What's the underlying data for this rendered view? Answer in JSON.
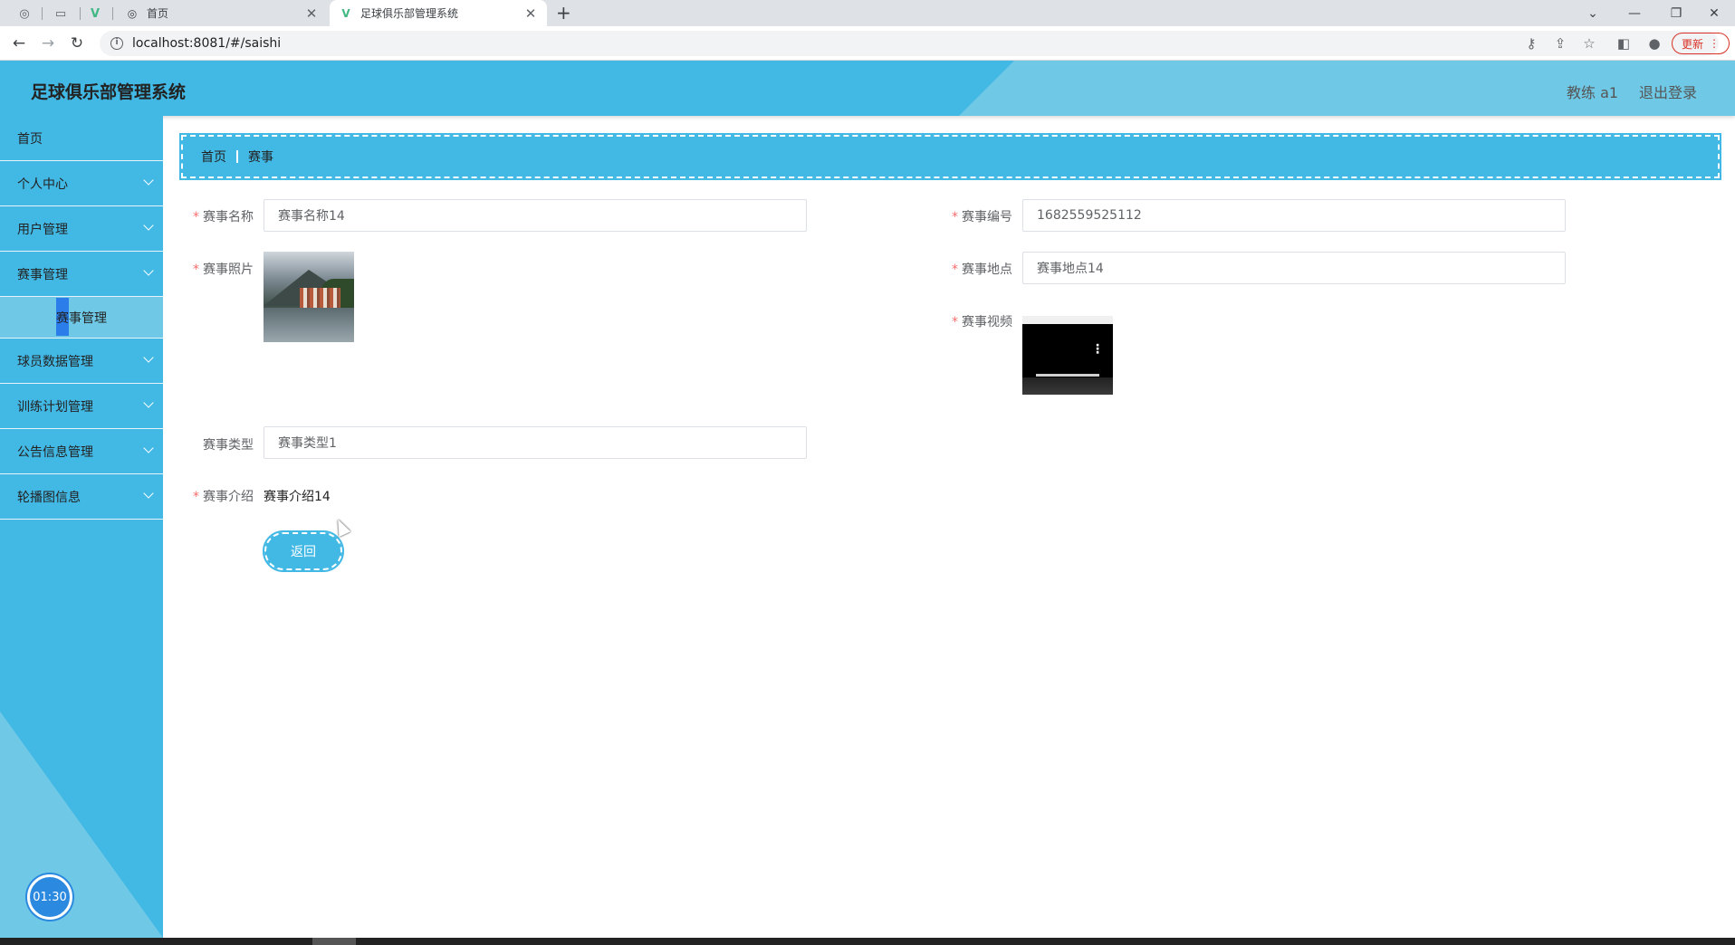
{
  "browser": {
    "tabs": [
      {
        "label": "首页",
        "active": false
      },
      {
        "label": "足球俱乐部管理系统",
        "active": true
      }
    ],
    "new_tab": "+",
    "url": "localhost:8081/#/saishi",
    "update_label": "更新"
  },
  "header": {
    "title": "足球俱乐部管理系统",
    "user": "教练 a1",
    "logout": "退出登录"
  },
  "sidebar": {
    "items": [
      {
        "label": "首页",
        "has_children": false
      },
      {
        "label": "个人中心",
        "has_children": true
      },
      {
        "label": "用户管理",
        "has_children": true
      },
      {
        "label": "赛事管理",
        "has_children": true
      },
      {
        "label": "球员数据管理",
        "has_children": true
      },
      {
        "label": "训练计划管理",
        "has_children": true
      },
      {
        "label": "公告信息管理",
        "has_children": true
      },
      {
        "label": "轮播图信息",
        "has_children": true
      }
    ],
    "submenu_label": "赛事管理",
    "timer": "01:30"
  },
  "breadcrumb": {
    "home": "首页",
    "current": "赛事"
  },
  "form": {
    "name_label": "赛事名称",
    "name_value": "赛事名称14",
    "number_label": "赛事编号",
    "number_value": "1682559525112",
    "photo_label": "赛事照片",
    "location_label": "赛事地点",
    "location_value": "赛事地点14",
    "video_label": "赛事视频",
    "type_label": "赛事类型",
    "type_value": "赛事类型1",
    "intro_label": "赛事介绍",
    "intro_value": "赛事介绍14",
    "back_button": "返回"
  },
  "colors": {
    "primary": "#42b8e4",
    "secondary": "#6fc9e6",
    "required": "#f56c6c"
  }
}
